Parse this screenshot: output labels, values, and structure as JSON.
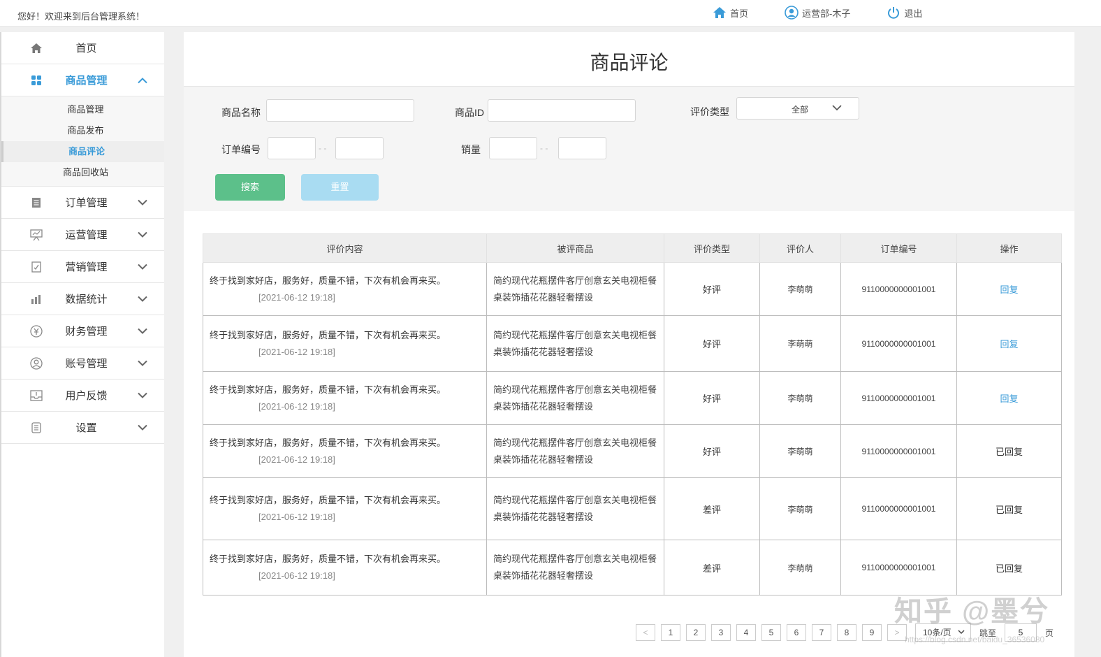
{
  "topbar": {
    "welcome": "您好！欢迎来到后台管理系统！",
    "home": "首页",
    "user": "运营部-木子",
    "logout": "退出"
  },
  "sidebar": {
    "home": "首页",
    "product_mgmt": "商品管理",
    "sub": [
      "商品管理",
      "商品发布",
      "商品评论",
      "商品回收站"
    ],
    "items": [
      "订单管理",
      "运营管理",
      "营销管理",
      "数据统计",
      "财务管理",
      "账号管理",
      "用户反馈",
      "设置"
    ]
  },
  "page": {
    "title": "商品评论"
  },
  "filter": {
    "name_label": "商品名称",
    "id_label": "商品ID",
    "type_label": "评价类型",
    "type_value": "全部",
    "order_label": "订单编号",
    "sales_label": "销量",
    "dash": "- -",
    "search": "搜索",
    "reset": "重置"
  },
  "table": {
    "headers": [
      "评价内容",
      "被评商品",
      "评价类型",
      "评价人",
      "订单编号",
      "操作"
    ],
    "rows": [
      {
        "content": "终于找到家好店，服务好，质量不错，下次有机会再来买。",
        "time": "[2021-06-12 19:18]",
        "goods1": "简约现代花瓶摆件客厅创意玄关电视柜餐",
        "goods2": "桌装饰插花花器轻奢摆设",
        "type": "好评",
        "user": "李萌萌",
        "order": "9110000000001001",
        "action": "回复"
      },
      {
        "content": "终于找到家好店，服务好，质量不错，下次有机会再来买。",
        "time": "[2021-06-12 19:18]",
        "goods1": "简约现代花瓶摆件客厅创意玄关电视柜餐",
        "goods2": "桌装饰插花花器轻奢摆设",
        "type": "好评",
        "user": "李萌萌",
        "order": "9110000000001001",
        "action": "回复"
      },
      {
        "content": "终于找到家好店，服务好，质量不错，下次有机会再来买。",
        "time": "[2021-06-12 19:18]",
        "goods1": "简约现代花瓶摆件客厅创意玄关电视柜餐",
        "goods2": "桌装饰插花花器轻奢摆设",
        "type": "好评",
        "user": "李萌萌",
        "order": "9110000000001001",
        "action": "回复"
      },
      {
        "content": "终于找到家好店，服务好，质量不错，下次有机会再来买。",
        "time": "[2021-06-12 19:18]",
        "goods1": "简约现代花瓶摆件客厅创意玄关电视柜餐",
        "goods2": "桌装饰插花花器轻奢摆设",
        "type": "好评",
        "user": "李萌萌",
        "order": "9110000000001001",
        "action": "已回复"
      },
      {
        "content": "终于找到家好店，服务好，质量不错，下次有机会再来买。",
        "time": "[2021-06-12 19:18]",
        "goods1": "简约现代花瓶摆件客厅创意玄关电视柜餐",
        "goods2": "桌装饰插花花器轻奢摆设",
        "type": "差评",
        "user": "李萌萌",
        "order": "9110000000001001",
        "action": "已回复"
      },
      {
        "content": "终于找到家好店，服务好，质量不错，下次有机会再来买。",
        "time": "[2021-06-12 19:18]",
        "goods1": "简约现代花瓶摆件客厅创意玄关电视柜餐",
        "goods2": "桌装饰插花花器轻奢摆设",
        "type": "差评",
        "user": "李萌萌",
        "order": "9110000000001001",
        "action": "已回复"
      }
    ]
  },
  "pager": {
    "prev": "<",
    "next": ">",
    "pages": [
      "1",
      "2",
      "3",
      "4",
      "5",
      "6",
      "7",
      "8",
      "9"
    ],
    "size": "10条/页",
    "jump": "跳至",
    "jump_value": "5",
    "page_suffix": "页"
  },
  "watermark": {
    "text": "知乎 @墨兮",
    "url": "https://blog.csdn.net/baidu_36536080"
  },
  "colors": {
    "accent": "#3a9bd8",
    "search_btn": "#5cc08a",
    "reset_btn": "#a9dcf2"
  }
}
